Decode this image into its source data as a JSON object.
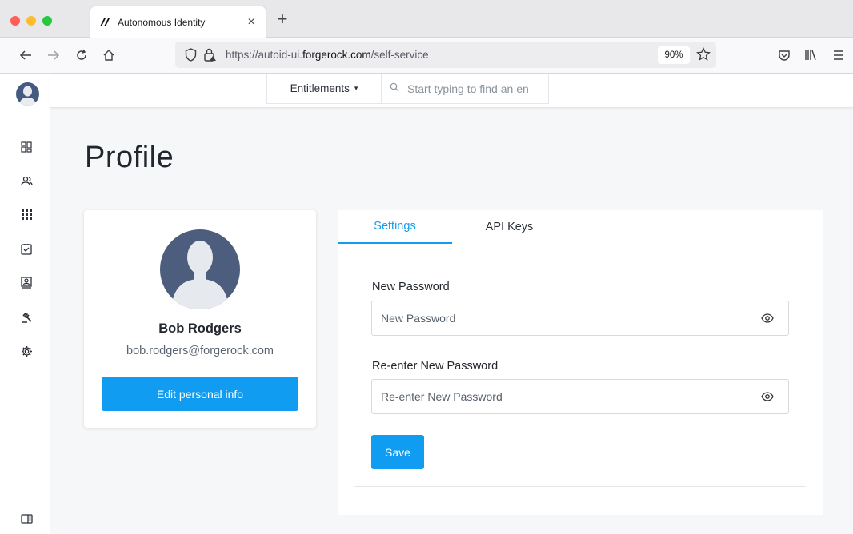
{
  "browser": {
    "tab_title": "Autonomous Identity",
    "tab_close": "×",
    "new_tab": "+",
    "url_prefix": "https://autoid-ui.",
    "url_domain": "forgerock.com",
    "url_path": "/self-service",
    "zoom": "90%"
  },
  "topbar": {
    "entity_type": "Entitlements",
    "search_placeholder": "Start typing to find an en"
  },
  "page": {
    "title": "Profile"
  },
  "profile": {
    "name": "Bob Rodgers",
    "email": "bob.rodgers@forgerock.com",
    "edit_label": "Edit personal info"
  },
  "tabs": [
    {
      "label": "Settings",
      "active": true
    },
    {
      "label": "API Keys",
      "active": false
    }
  ],
  "form": {
    "new_password_label": "New Password",
    "new_password_placeholder": "New Password",
    "reenter_label": "Re-enter New Password",
    "reenter_placeholder": "Re-enter New Password",
    "save_label": "Save"
  },
  "sidebar": {
    "icons": [
      "dashboard-icon",
      "users-icon",
      "apps-icon",
      "tasks-icon",
      "identities-icon",
      "rules-icon",
      "settings-icon",
      "panel-toggle-icon"
    ]
  },
  "colors": {
    "accent": "#109cf1",
    "avatar": "#4d5d7d"
  }
}
